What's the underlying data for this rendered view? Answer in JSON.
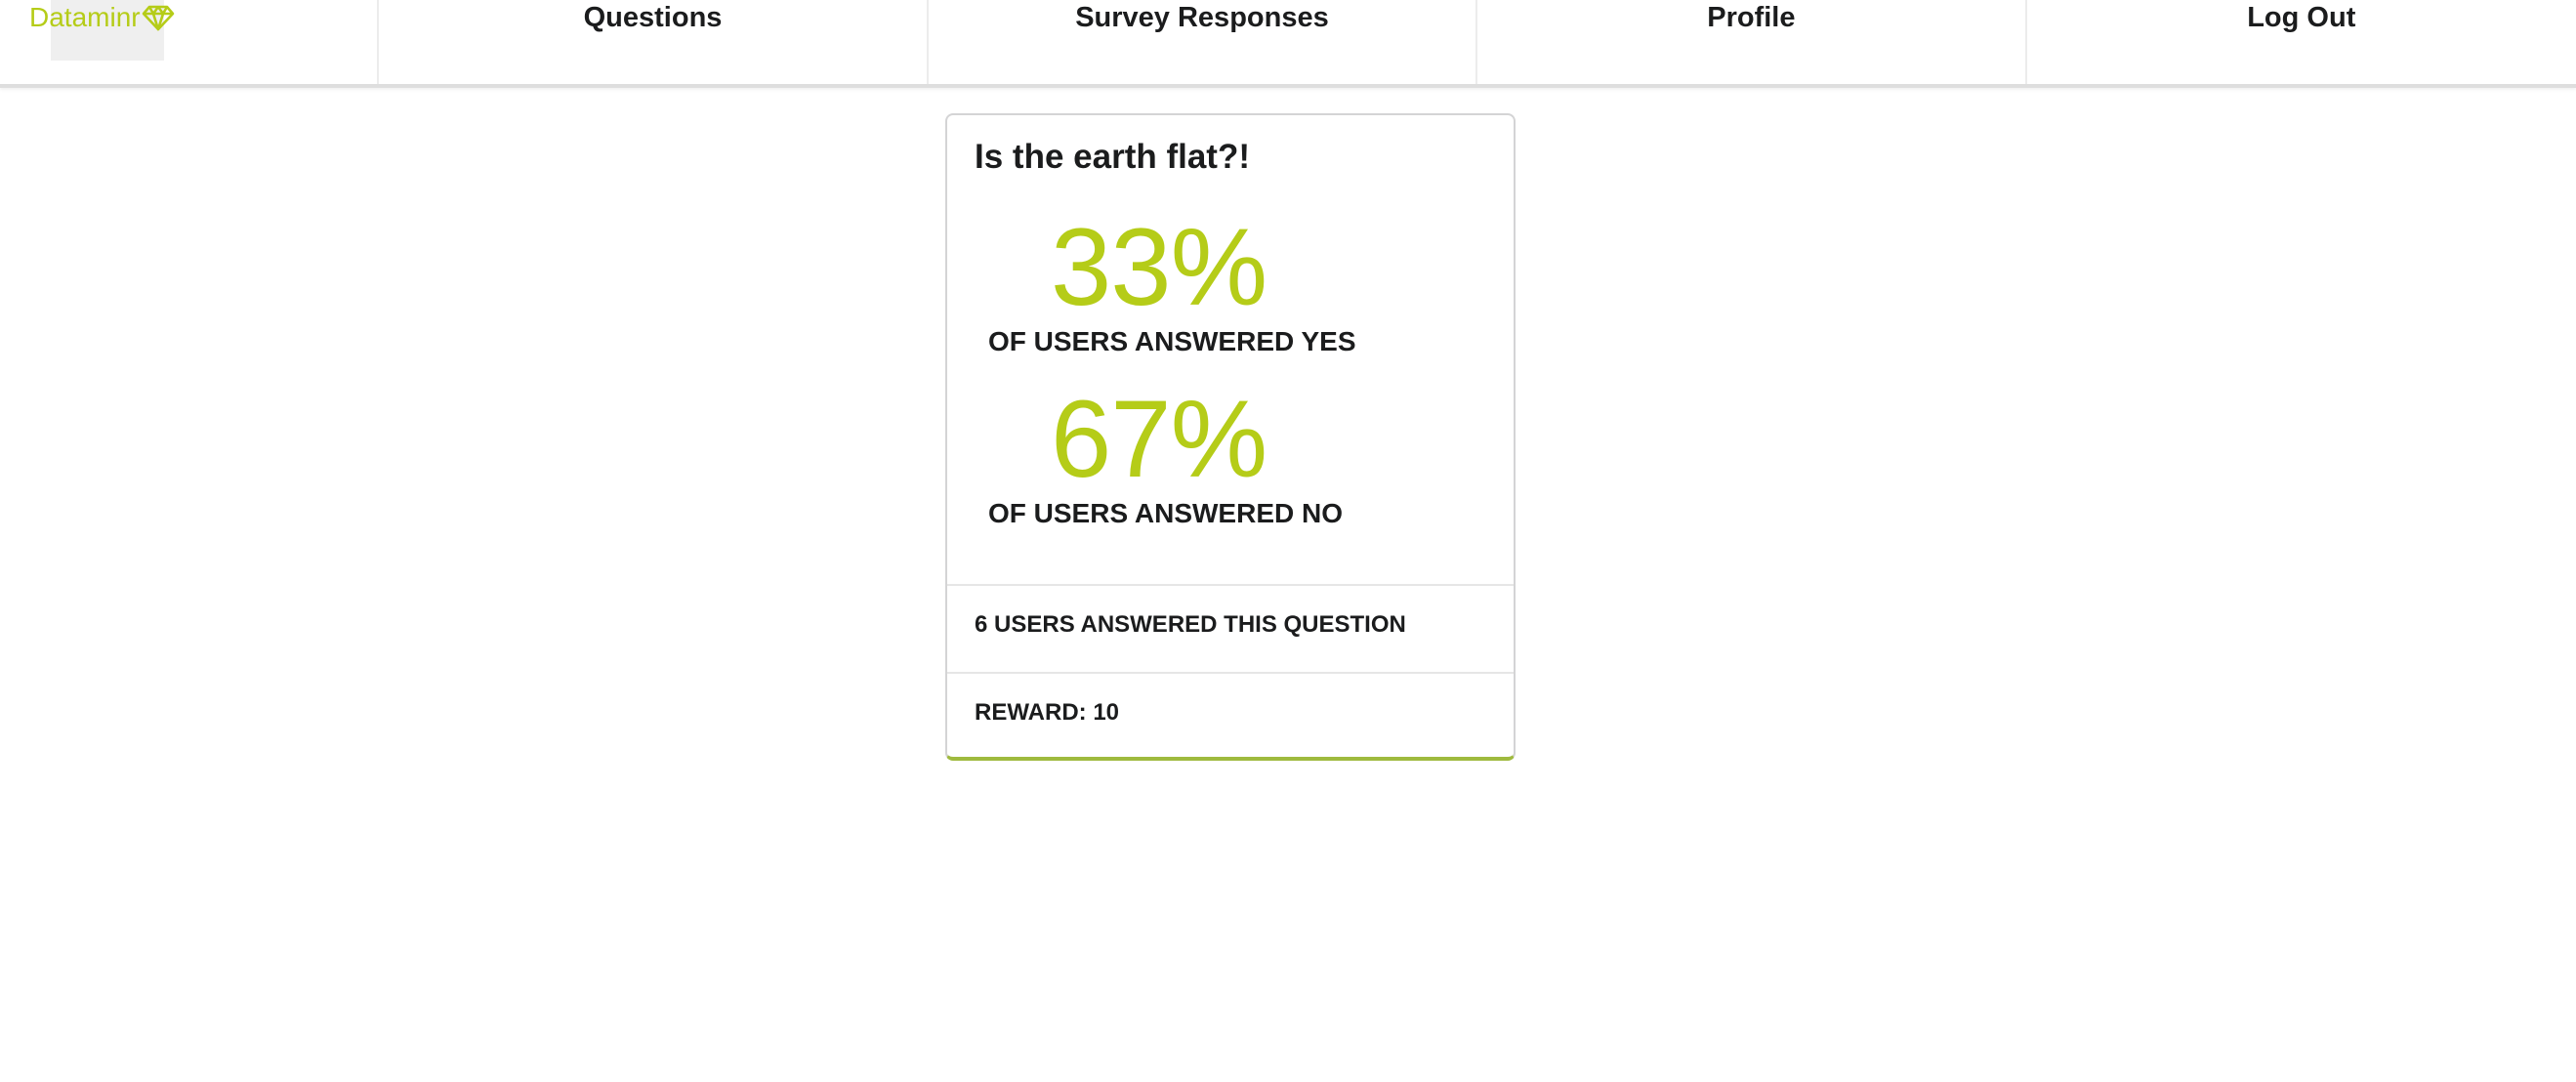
{
  "nav": {
    "brand": "Dataminr",
    "brand_icon": "diamond-icon",
    "items": [
      {
        "label": "Questions"
      },
      {
        "label": "Survey Responses"
      },
      {
        "label": "Profile"
      },
      {
        "label": "Log Out"
      }
    ]
  },
  "card": {
    "title": "Is the earth flat?!",
    "yes": {
      "value": "33%",
      "label": "OF USERS ANSWERED YES"
    },
    "no": {
      "value": "67%",
      "label": "OF USERS ANSWERED NO"
    },
    "users_answered": "6 USERS ANSWERED THIS QUESTION",
    "reward": "REWARD: 10"
  },
  "colors": {
    "accent": "#b5cc18",
    "card_bottom_border": "#9fba3e",
    "text": "#1b1c1d"
  }
}
